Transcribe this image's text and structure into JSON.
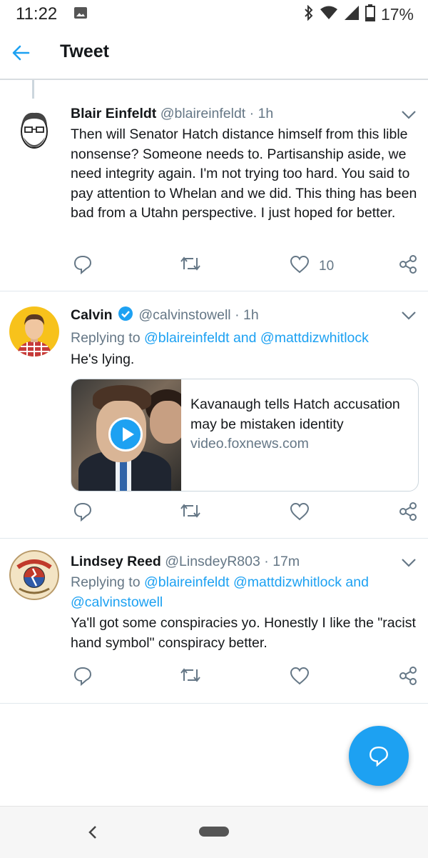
{
  "status_bar": {
    "time": "11:22",
    "battery": "17%",
    "icons": [
      "image-icon",
      "bluetooth-icon",
      "wifi-icon",
      "signal-icon",
      "battery-icon"
    ]
  },
  "header": {
    "title": "Tweet",
    "back_icon": "back-arrow-icon"
  },
  "tweets": [
    {
      "name": "Blair Einfeldt",
      "handle": "@blaireinfeldt",
      "separator": "·",
      "time": "1h",
      "text": "Then will Senator Hatch distance himself from this lible nonsense? Someone needs to. Partisanship aside, we need integrity again. I'm not trying too hard. You said to pay attention to Whelan and we did. This thing has been bad from a Utahn perspective. I just hoped for better.",
      "like_count": "10"
    },
    {
      "name": "Calvin",
      "handle": "@calvinstowell",
      "separator": "·",
      "time": "1h",
      "replying_prefix": "Replying to",
      "mention1": "@blaireinfeldt",
      "joiner": "and",
      "mention2": "@mattdizwhitlock",
      "text": "He's lying.",
      "card": {
        "title": "Kavanaugh tells Hatch accusation may be mistaken identity",
        "domain": "video.foxnews.com"
      }
    },
    {
      "name": "Lindsey Reed",
      "handle": "@LinsdeyR803",
      "separator": "·",
      "time": "17m",
      "replying_prefix": "Replying to",
      "mention1": "@blaireinfeldt",
      "mention2": "@mattdizwhitlock",
      "joiner": "and",
      "mention3": "@calvinstowell",
      "text": "Ya'll got some conspiracies yo. Honestly I like the \"racist hand symbol\" conspiracy better."
    }
  ],
  "colors": {
    "accent": "#1da1f2",
    "muted": "#657786",
    "text": "#14171a",
    "border": "#e1e8ed"
  }
}
